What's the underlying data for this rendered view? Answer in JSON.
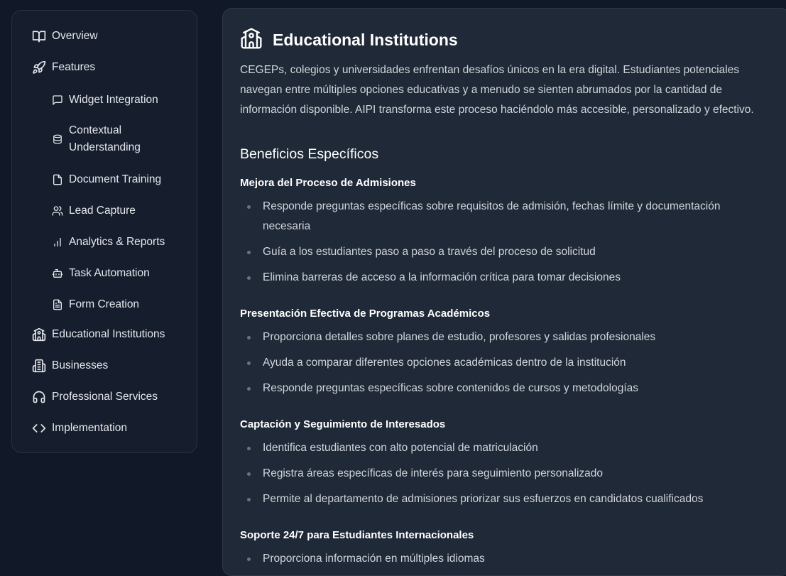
{
  "sidebar": {
    "items": [
      {
        "label": "Overview",
        "icon": "book-open-icon"
      },
      {
        "label": "Features",
        "icon": "rocket-icon"
      },
      {
        "label": "Widget Integration",
        "icon": "message-square-icon"
      },
      {
        "label": "Contextual Understanding",
        "icon": "database-icon"
      },
      {
        "label": "Document Training",
        "icon": "file-icon"
      },
      {
        "label": "Lead Capture",
        "icon": "users-icon"
      },
      {
        "label": "Analytics & Reports",
        "icon": "bar-chart-icon"
      },
      {
        "label": "Task Automation",
        "icon": "bot-icon"
      },
      {
        "label": "Form Creation",
        "icon": "file-text-icon"
      },
      {
        "label": "Educational Institutions",
        "icon": "school-icon"
      },
      {
        "label": "Businesses",
        "icon": "building-icon"
      },
      {
        "label": "Professional Services",
        "icon": "headphones-icon"
      },
      {
        "label": "Implementation",
        "icon": "code-icon"
      }
    ]
  },
  "main": {
    "title": "Educational Institutions",
    "title_icon": "school-icon",
    "intro": "CEGEPs, colegios y universidades enfrentan desafíos únicos en la era digital. Estudiantes potenciales navegan entre múltiples opciones educativas y a menudo se sienten abrumados por la cantidad de información disponible. AIPI transforma este proceso haciéndolo más accesible, personalizado y efectivo.",
    "section_title": "Beneficios Específicos",
    "subsections": [
      {
        "title": "Mejora del Proceso de Admisiones",
        "items": [
          "Responde preguntas específicas sobre requisitos de admisión, fechas límite y documentación necesaria",
          "Guía a los estudiantes paso a paso a través del proceso de solicitud",
          "Elimina barreras de acceso a la información crítica para tomar decisiones"
        ]
      },
      {
        "title": "Presentación Efectiva de Programas Académicos",
        "items": [
          "Proporciona detalles sobre planes de estudio, profesores y salidas profesionales",
          "Ayuda a comparar diferentes opciones académicas dentro de la institución",
          "Responde preguntas específicas sobre contenidos de cursos y metodologías"
        ]
      },
      {
        "title": "Captación y Seguimiento de Interesados",
        "items": [
          "Identifica estudiantes con alto potencial de matriculación",
          "Registra áreas específicas de interés para seguimiento personalizado",
          "Permite al departamento de admisiones priorizar sus esfuerzos en candidatos cualificados"
        ]
      },
      {
        "title": "Soporte 24/7 para Estudiantes Internacionales",
        "items": [
          "Proporciona información en múltiples idiomas"
        ]
      }
    ]
  },
  "colors": {
    "page_bg": "#111827",
    "sidebar_bg": "#161e2e",
    "card_bg": "#1f2937",
    "text": "#d1d5db",
    "heading": "#ffffff"
  }
}
